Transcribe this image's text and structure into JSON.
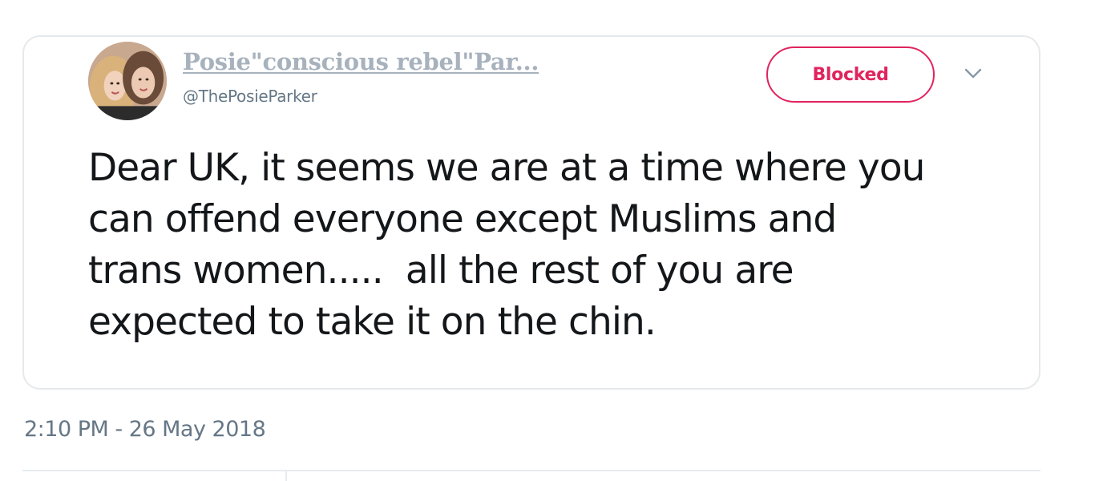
{
  "tweet": {
    "author": {
      "display_name": "Posie\"conscious rebel\"Par...",
      "handle": "@ThePosieParker",
      "avatar_icon": "profile-photo"
    },
    "follow_button_label": "Blocked",
    "menu_icon": "chevron-down-icon",
    "text_lines": [
      "Dear UK, it seems we are at a time where you",
      "can offend everyone except Muslims and",
      "trans women.....  all the rest of you are",
      "expected to take it on the chin."
    ],
    "timestamp": "2:10 PM - 26 May 2018"
  },
  "colors": {
    "blocked_accent": "#e0245e",
    "muted_text": "#657786",
    "body_text": "#14171a",
    "border": "#e6e9ec"
  }
}
